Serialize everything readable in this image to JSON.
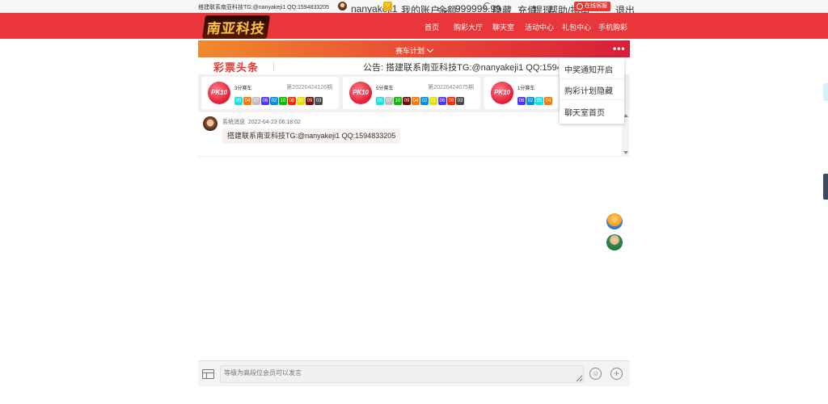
{
  "topbar": {
    "left_text": "搭建联系南亚科技TG:@nanyakeji1 QQ:1594833205",
    "username": "nanyakeji1",
    "account_label": "我的账户",
    "balance_label": "余额:",
    "balance_value": "999999.99",
    "hide_label": "隐藏",
    "deposit_label": "充值",
    "withdraw_label": "提现",
    "help_label": "帮助/指南",
    "service_label": "在线客服",
    "logout_label": "退出",
    "separator": "|",
    "vip_text": "V"
  },
  "nav": {
    "logo_text": "南亚科技",
    "items": [
      "首页",
      "购彩大厅",
      "聊天室",
      "活动中心",
      "礼包中心",
      "手机购彩"
    ]
  },
  "plan": {
    "title": "赛车计划",
    "more": "•••"
  },
  "announce": {
    "brand": "彩票头条",
    "notice": "公告: 搭建联系南亚科技TG:@nanyakeji1 QQ:1594833205"
  },
  "lotteries": [
    {
      "logo": "PK10",
      "name": "3分赛车",
      "period": "第20220424126期",
      "balls": [
        "05",
        "04",
        "07",
        "06",
        "02",
        "10",
        "08",
        "01",
        "09",
        "03"
      ]
    },
    {
      "logo": "PK10",
      "name": "5分赛车",
      "period": "第20220424075期",
      "balls": [
        "05",
        "07",
        "10",
        "09",
        "04",
        "02",
        "01",
        "06",
        "08",
        "03"
      ]
    },
    {
      "logo": "PK10",
      "name": "1分赛车",
      "period": "",
      "balls": [
        "06",
        "02",
        "05",
        "04"
      ]
    }
  ],
  "ball_colors": {
    "01": "#e6de00",
    "02": "#0092dd",
    "03": "#4b4b4b",
    "04": "#ff7600",
    "05": "#17e2e5",
    "06": "#5234ff",
    "07": "#bfbfbf",
    "08": "#ff2600",
    "09": "#780b00",
    "10": "#07bf00"
  },
  "message": {
    "sender": "系统消息",
    "time": "2022-04-23 06:18:02",
    "text": "搭建联系南亚科技TG:@nanyakeji1 QQ:1594833205"
  },
  "dropdown": {
    "items": [
      "中奖通知开启",
      "购彩计划隐藏",
      "聊天室首页"
    ]
  },
  "input": {
    "placeholder": "等级为高段位会员可以发言"
  },
  "icons": {
    "emoji": "☺",
    "plus": "+"
  }
}
